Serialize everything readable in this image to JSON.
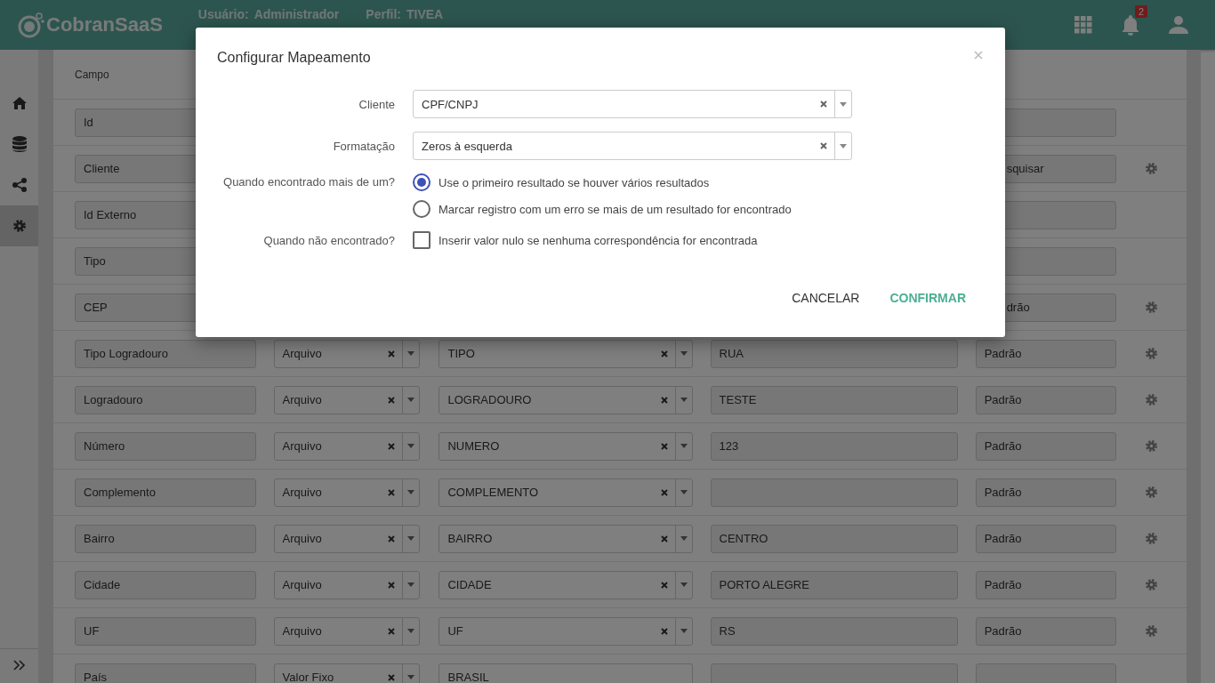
{
  "header": {
    "brand": "CobranSaaS",
    "user_label": "Usuário:",
    "user": "Administrador",
    "profile_label": "Perfil:",
    "profile": "TIVEA",
    "notifications": "2"
  },
  "sidebar": {
    "items": [
      {
        "selected": false
      },
      {
        "selected": false
      },
      {
        "selected": false
      },
      {
        "selected": true
      }
    ]
  },
  "table": {
    "columns": [
      "Campo"
    ],
    "rows": [
      {
        "campo": "Id",
        "padrao": "",
        "settings": false
      },
      {
        "campo": "Cliente",
        "padrao": "squisar",
        "settings": true
      },
      {
        "campo": "Id Externo",
        "padrao": "",
        "settings": false
      },
      {
        "campo": "Tipo",
        "padrao": "",
        "settings": false
      },
      {
        "campo": "CEP",
        "padrao": "drão",
        "settings": true
      },
      {
        "campo": "Tipo Logradouro",
        "origem": "Arquivo",
        "valor": "TIPO",
        "kind": "select",
        "fixo": "RUA",
        "padrao": "Padrão",
        "settings": true
      },
      {
        "campo": "Logradouro",
        "origem": "Arquivo",
        "valor": "LOGRADOURO",
        "kind": "select",
        "fixo": "TESTE",
        "padrao": "Padrão",
        "settings": true
      },
      {
        "campo": "Número",
        "origem": "Arquivo",
        "valor": "NUMERO",
        "kind": "select",
        "fixo": "123",
        "padrao": "Padrão",
        "settings": true
      },
      {
        "campo": "Complemento",
        "origem": "Arquivo",
        "valor": "COMPLEMENTO",
        "kind": "select",
        "fixo": "",
        "padrao": "Padrão",
        "settings": true
      },
      {
        "campo": "Bairro",
        "origem": "Arquivo",
        "valor": "BAIRRO",
        "kind": "select",
        "fixo": "CENTRO",
        "padrao": "Padrão",
        "settings": true
      },
      {
        "campo": "Cidade",
        "origem": "Arquivo",
        "valor": "CIDADE",
        "kind": "select",
        "fixo": "PORTO ALEGRE",
        "padrao": "Padrão",
        "settings": true
      },
      {
        "campo": "UF",
        "origem": "Arquivo",
        "valor": "UF",
        "kind": "select",
        "fixo": "RS",
        "padrao": "Padrão",
        "settings": true
      },
      {
        "campo": "País",
        "origem": "Valor Fixo",
        "valor": "BRASIL",
        "kind": "input",
        "fixo": "",
        "padrao": "",
        "settings": false
      }
    ]
  },
  "dialog": {
    "title": "Configurar Mapeamento",
    "fields": [
      {
        "label": "Cliente",
        "value": "CPF/CNPJ"
      },
      {
        "label": "Formatação",
        "value": "Zeros à esquerda"
      }
    ],
    "multiple": {
      "label": "Quando encontrado mais de um?",
      "options": [
        {
          "label": "Use o primeiro resultado se houver vários resultados",
          "selected": true
        },
        {
          "label": "Marcar registro com um erro se mais de um resultado for encontrado",
          "selected": false
        }
      ]
    },
    "not_found": {
      "label": "Quando não encontrado?",
      "option": "Inserir valor nulo se nenhuma correspondência for encontrada",
      "checked": false
    },
    "buttons": [
      {
        "label": "CANCELAR",
        "kind": "secondary"
      },
      {
        "label": "CONFIRMAR",
        "kind": "primary"
      }
    ]
  }
}
